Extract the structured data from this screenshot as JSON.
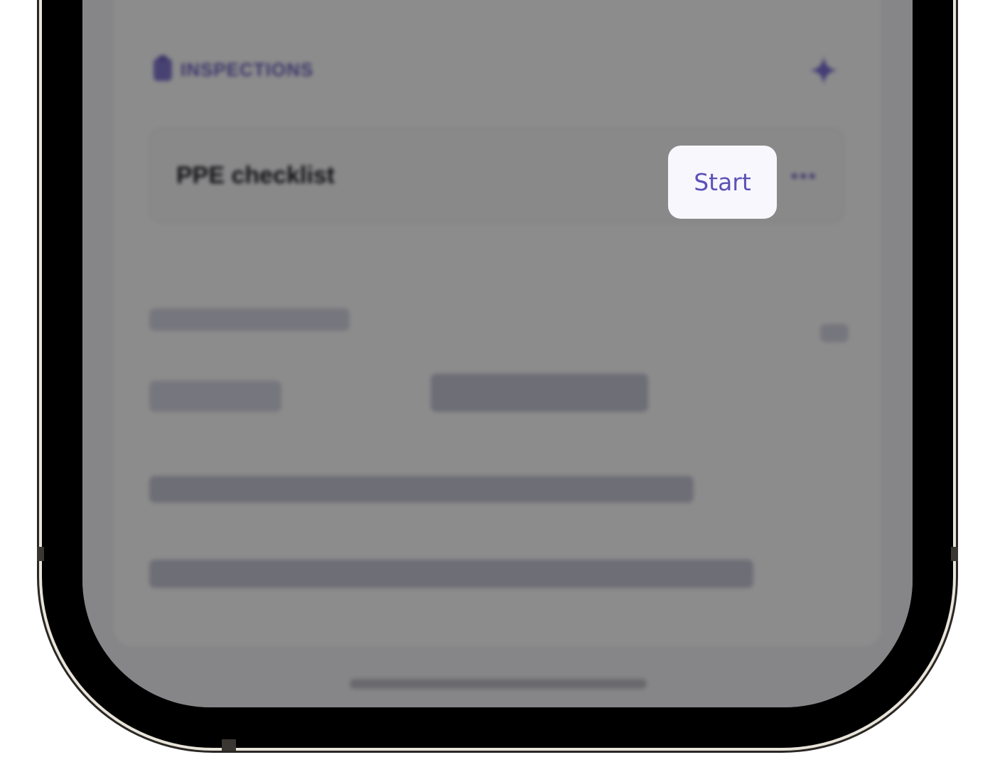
{
  "section": {
    "title": "INSPECTIONS",
    "icon": "clipboard-icon",
    "action_icon": "sparkle-icon"
  },
  "inspection": {
    "name": "PPE checklist",
    "start_label": "Start",
    "more_label": "•••"
  },
  "colors": {
    "accent": "#5b52b6",
    "button_bg": "#f8f7fd"
  }
}
